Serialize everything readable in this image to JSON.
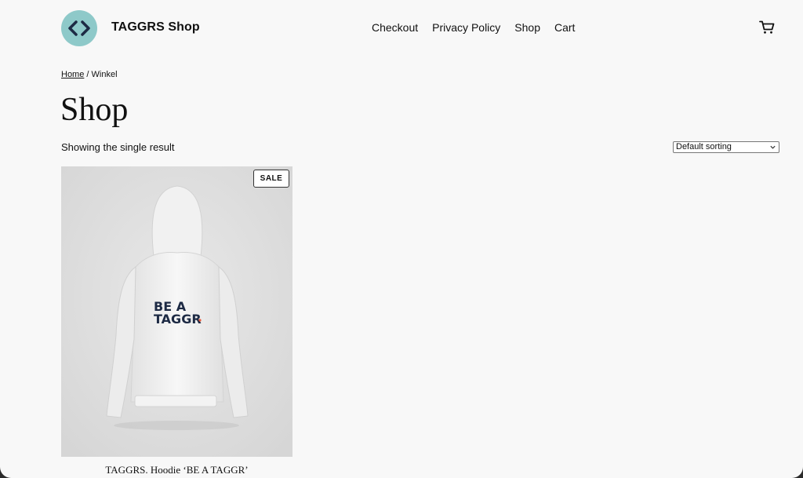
{
  "header": {
    "site_title": "TAGGRS Shop",
    "logo_icon": "code-brackets-icon",
    "nav": [
      {
        "label": "Checkout"
      },
      {
        "label": "Privacy Policy"
      },
      {
        "label": "Shop"
      },
      {
        "label": "Cart"
      }
    ],
    "cart_icon": "cart-icon"
  },
  "breadcrumb": {
    "home": "Home",
    "separator": "/",
    "current": "Winkel"
  },
  "page": {
    "title": "Shop",
    "result_count": "Showing the single result",
    "sorting": {
      "selected": "Default sorting"
    }
  },
  "products": [
    {
      "name": "TAGGRS. Hoodie ‘BE A TAGGR’",
      "badge": "SALE",
      "image_text": {
        "line1": "BE A",
        "line2": "TAGGR"
      }
    }
  ],
  "colors": {
    "logo_bg": "#8ec9c9",
    "logo_fg": "#1d2a44",
    "print_navy": "#1d2a44",
    "print_dot": "#e85d3f"
  }
}
